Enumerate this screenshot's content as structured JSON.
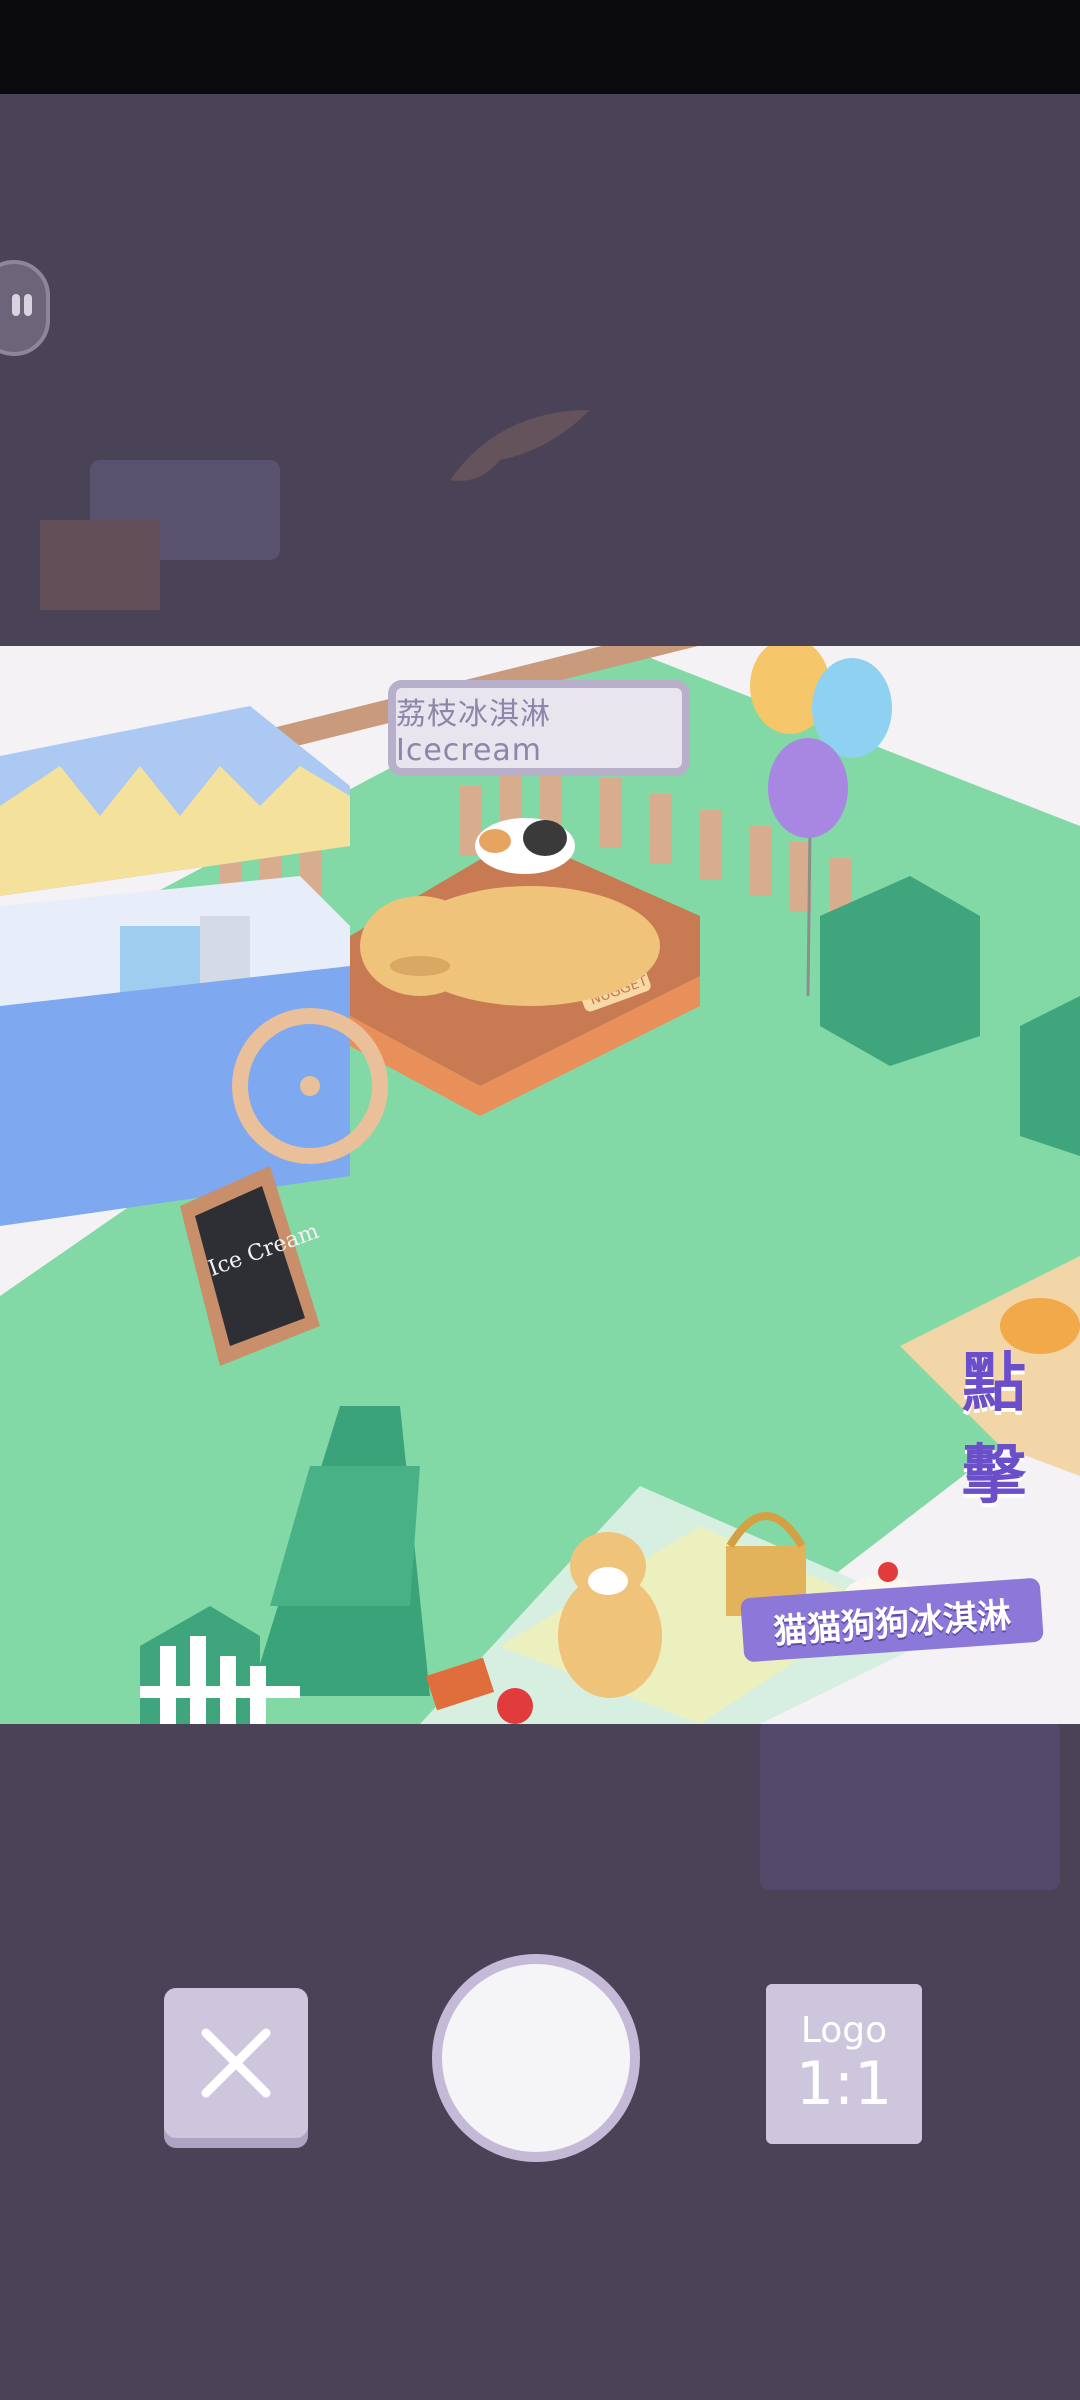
{
  "scene": {
    "shop_sign": "荔枝冰淇淋 Icecream",
    "game_title": "猫猫狗狗冰淇淋",
    "tap_text": "點擊",
    "chalkboard_text": "Ice Cream",
    "bed_tag": "NUGGET"
  },
  "controls": {
    "close_icon": "close-icon",
    "logo_label_top": "Logo",
    "logo_label_bottom": "1:1"
  },
  "colors": {
    "dim_background": "#4a4257",
    "grass": "#82d9a5",
    "button": "#cdc6dd",
    "accent_purple": "#8c78d8"
  }
}
